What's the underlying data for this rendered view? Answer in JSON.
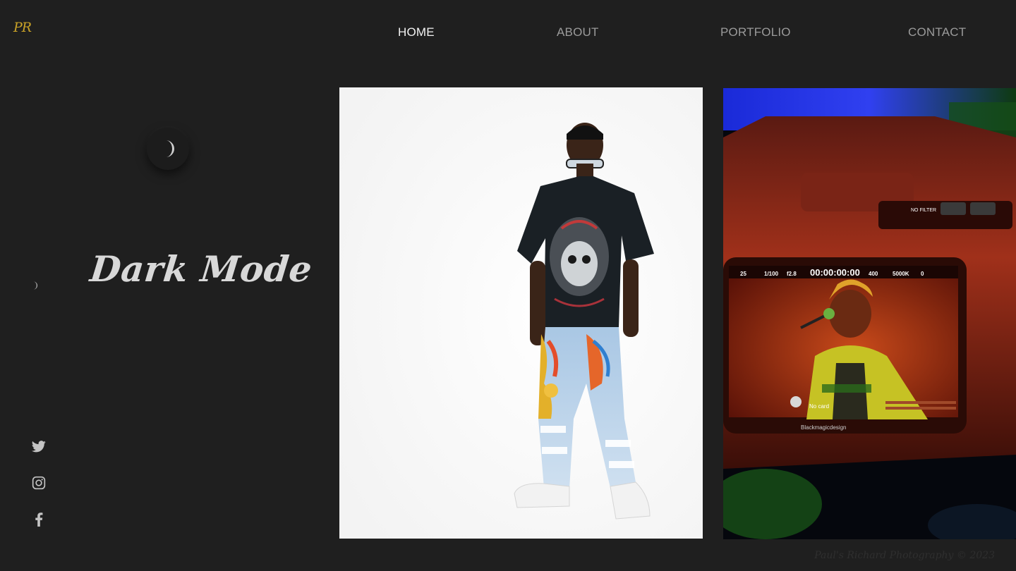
{
  "brand": {
    "logo_text": "PR"
  },
  "nav": {
    "items": [
      {
        "label": "HOME",
        "active": true
      },
      {
        "label": "ABOUT",
        "active": false
      },
      {
        "label": "PORTFOLIO",
        "active": false
      },
      {
        "label": "CONTACT",
        "active": false
      }
    ]
  },
  "sidebar": {
    "mode_title": "Dark Mode",
    "theme_toggle_icon": "moon-icon",
    "social": [
      {
        "icon": "twitter-icon"
      },
      {
        "icon": "instagram-icon"
      },
      {
        "icon": "facebook-icon"
      }
    ]
  },
  "gallery": {
    "photos": [
      {
        "subject": "model-in-graphic-tee-and-painted-jeans"
      },
      {
        "subject": "camera-monitor-showing-performer"
      }
    ],
    "camera_readout": {
      "timecode": "00:00:00:00",
      "shutter": "1/100",
      "aperture": "f2.8",
      "white_balance": "5000K",
      "fps": "25",
      "iso": "400",
      "tint": "0",
      "filter_label": "NO FILTER",
      "card_status": "No card",
      "brand": "Blackmagicdesign"
    }
  },
  "footer": {
    "signature": "Paul's Richard Photography © 2023"
  },
  "colors": {
    "background": "#1f1f1f",
    "logo": "#c9a227",
    "nav_active": "#f2f2f2",
    "nav_inactive": "#9b9b9b",
    "title": "#d8d8d8"
  }
}
